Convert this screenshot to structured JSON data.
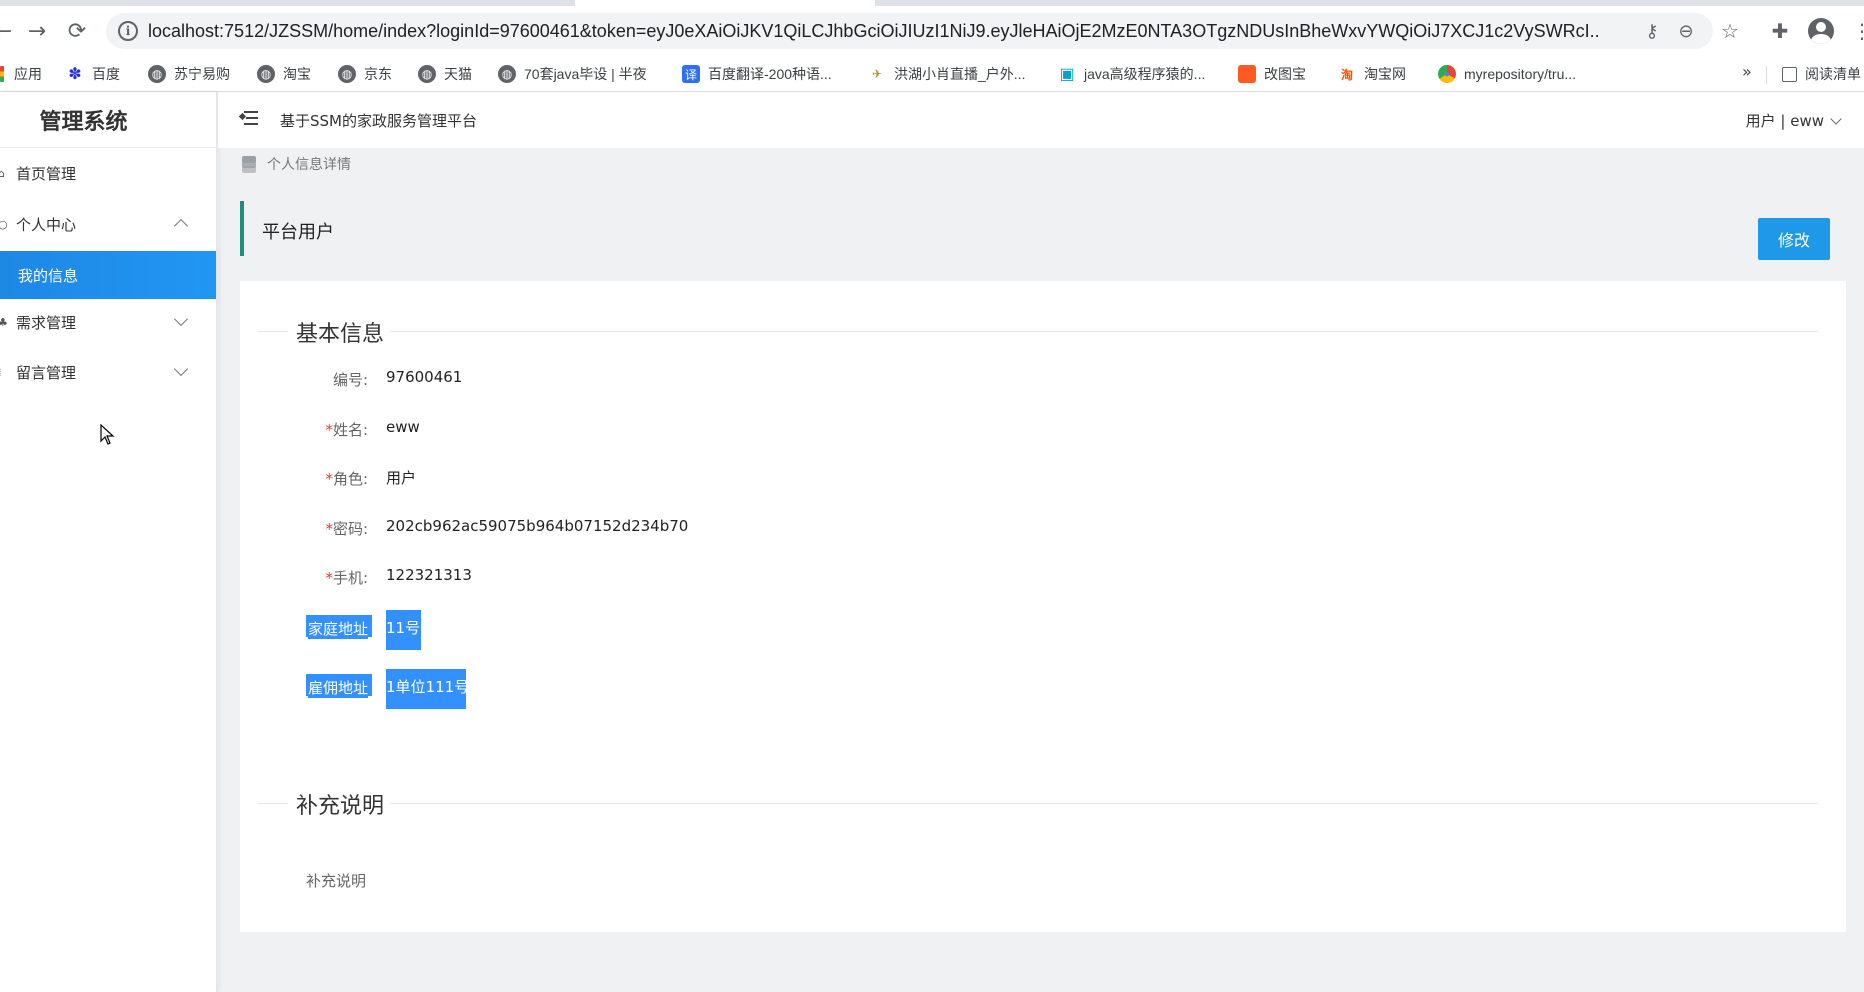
{
  "browser": {
    "url": "localhost:7512/JZSSM/home/index?loginId=97600461&token=eyJ0eXAiOiJKV1QiLCJhbGciOiJIUzI1NiJ9.eyJleHAiOjE2MzE0NTA3OTgzNDUsInBheWxvYWQiOiJ7XCJ1c2VySWRcI...",
    "bookmarks": [
      {
        "label": "应用",
        "icon": "apps-grid-icon"
      },
      {
        "label": "百度",
        "icon": "baidu-paw-icon"
      },
      {
        "label": "苏宁易购",
        "icon": "globe-icon"
      },
      {
        "label": "淘宝",
        "icon": "globe-icon"
      },
      {
        "label": "京东",
        "icon": "globe-icon"
      },
      {
        "label": "天猫",
        "icon": "globe-icon"
      },
      {
        "label": "70套java毕设 | 半夜",
        "icon": "globe-icon"
      },
      {
        "label": "百度翻译-200种语...",
        "icon": "translate-icon"
      },
      {
        "label": "洪湖小肖直播_户外...",
        "icon": "bird-icon"
      },
      {
        "label": "java高级程序猿的...",
        "icon": "bilibili-icon"
      },
      {
        "label": "改图宝",
        "icon": "gaitubao-icon"
      },
      {
        "label": "淘宝网",
        "icon": "taobao-icon"
      },
      {
        "label": "myrepository/tru...",
        "icon": "chrome-icon"
      }
    ],
    "more_label": "»",
    "reading_list_label": "阅读清单",
    "info_glyph": "i",
    "icon_glyphs": {
      "back": "←",
      "forward": "→",
      "reload": "⟳",
      "key": "⚷",
      "zoom": "⊖",
      "star": "☆",
      "puzzle": "✚",
      "more": "⋮",
      "paw": "✽",
      "translate": "译",
      "bird": "✈",
      "bili": "▣",
      "taobao": "淘",
      "chrome": "●",
      "globe": "◍"
    }
  },
  "sidebar": {
    "brand": "管理系统",
    "items": [
      {
        "label": "首页管理",
        "icon": "home-icon",
        "glyph": "⌂"
      },
      {
        "label": "个人中心",
        "icon": "user-center-icon",
        "glyph": "○",
        "expanded": true
      },
      {
        "label": "我的信息",
        "active": true
      },
      {
        "label": "需求管理",
        "icon": "demand-icon",
        "glyph": "♣"
      },
      {
        "label": "留言管理",
        "icon": "message-icon",
        "glyph": "⁞"
      }
    ]
  },
  "header": {
    "title": "基于SSM的家政服务管理平台",
    "user": "用户 | eww"
  },
  "breadcrumb": "个人信息详情",
  "panel": {
    "title": "平台用户",
    "edit_button": "修改"
  },
  "basic_info": {
    "section_title": "基本信息",
    "fields": [
      {
        "label": "编号:",
        "required": false,
        "value": "97600461"
      },
      {
        "label": "姓名:",
        "required": true,
        "value": "eww"
      },
      {
        "label": "角色:",
        "required": true,
        "value": "用户"
      },
      {
        "label": "密码:",
        "required": true,
        "value": "202cb962ac59075b964b07152d234b70"
      },
      {
        "label": "手机:",
        "required": true,
        "value": "122321313"
      },
      {
        "label": "家庭地址",
        "required": false,
        "value": "11号",
        "selected": true
      },
      {
        "label": "雇佣地址",
        "required": false,
        "value": "1单位111号",
        "selected": true
      }
    ],
    "required_mark": "*"
  },
  "supplement": {
    "section_title": "补充说明",
    "label": "补充说明"
  },
  "colors": {
    "accent_teal": "#1e8f7a",
    "primary_blue": "#1e98e9",
    "selection_blue": "#3390ff",
    "required_red": "#e53935"
  }
}
